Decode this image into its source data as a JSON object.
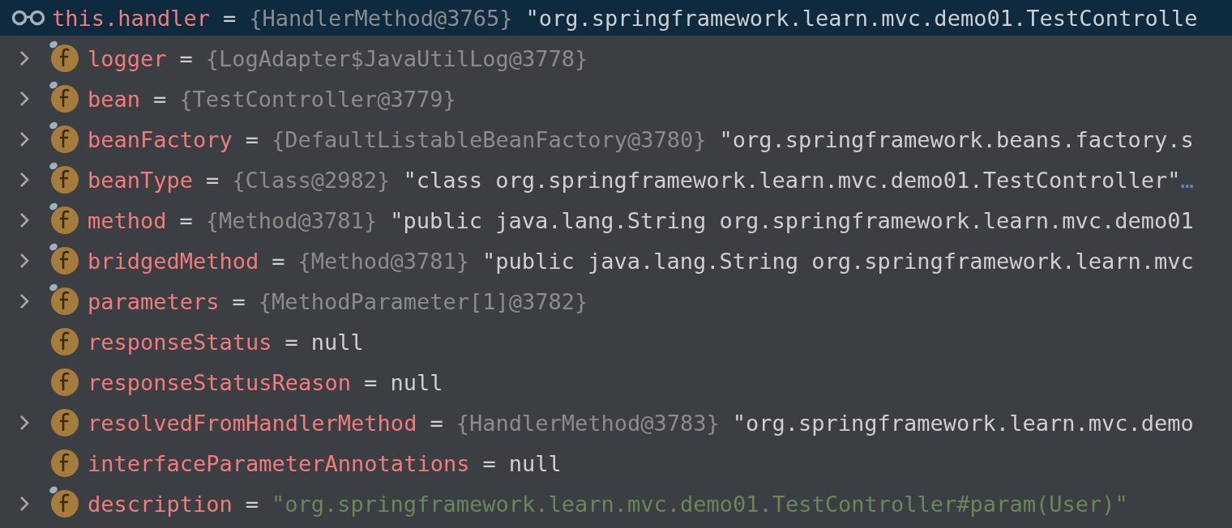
{
  "watch": {
    "name": "this.handler",
    "eq": "=",
    "type": "{HandlerMethod@3765}",
    "value": "\"org.springframework.learn.mvc.demo01.TestControlle"
  },
  "fields": [
    {
      "name": "logger",
      "eq": "=",
      "expandable": true,
      "final": true,
      "type": "{LogAdapter$JavaUtilLog@3778}"
    },
    {
      "name": "bean",
      "eq": "=",
      "expandable": true,
      "final": true,
      "type": "{TestController@3779}"
    },
    {
      "name": "beanFactory",
      "eq": "=",
      "expandable": true,
      "final": true,
      "type": "{DefaultListableBeanFactory@3780}",
      "value": "\"org.springframework.beans.factory.s",
      "kind": "object"
    },
    {
      "name": "beanType",
      "eq": "=",
      "expandable": true,
      "final": true,
      "type": "{Class@2982}",
      "value": "\"class org.springframework.learn.mvc.demo01.TestController\"",
      "kind": "object",
      "more": "…"
    },
    {
      "name": "method",
      "eq": "=",
      "expandable": true,
      "final": true,
      "type": "{Method@3781}",
      "value": "\"public java.lang.String org.springframework.learn.mvc.demo01",
      "kind": "object"
    },
    {
      "name": "bridgedMethod",
      "eq": "=",
      "expandable": true,
      "final": true,
      "type": "{Method@3781}",
      "value": "\"public java.lang.String org.springframework.learn.mvc",
      "kind": "object"
    },
    {
      "name": "parameters",
      "eq": "=",
      "expandable": true,
      "final": true,
      "type": "{MethodParameter[1]@3782}"
    },
    {
      "name": "responseStatus",
      "eq": "=",
      "expandable": false,
      "final": false,
      "value": "null",
      "kind": "null"
    },
    {
      "name": "responseStatusReason",
      "eq": "=",
      "expandable": false,
      "final": false,
      "value": "null",
      "kind": "null"
    },
    {
      "name": "resolvedFromHandlerMethod",
      "eq": "=",
      "expandable": true,
      "final": false,
      "type": "{HandlerMethod@3783}",
      "value": "\"org.springframework.learn.mvc.demo",
      "kind": "object"
    },
    {
      "name": "interfaceParameterAnnotations",
      "eq": "=",
      "expandable": false,
      "final": false,
      "value": "null",
      "kind": "null"
    },
    {
      "name": "description",
      "eq": "=",
      "expandable": true,
      "final": true,
      "value": "\"org.springframework.learn.mvc.demo01.TestController#param(User)\"",
      "kind": "string"
    }
  ]
}
